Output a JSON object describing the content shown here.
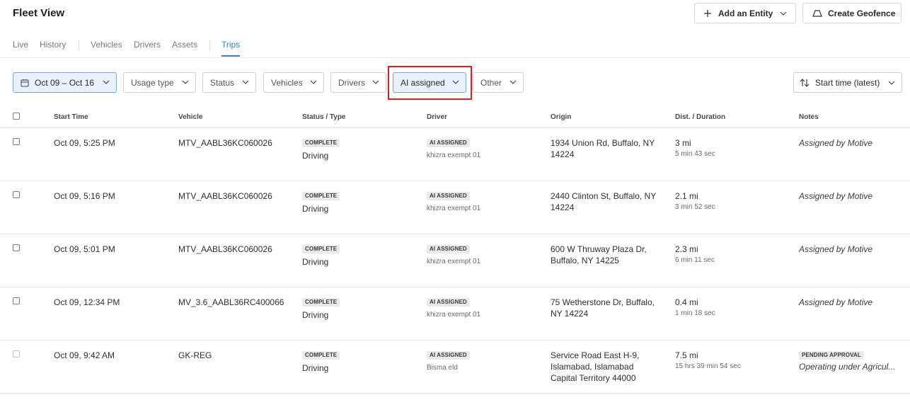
{
  "header": {
    "title": "Fleet View",
    "add_entity_label": "Add an Entity",
    "create_geofence_label": "Create Geofence"
  },
  "tabs": [
    "Live",
    "History",
    "Vehicles",
    "Drivers",
    "Assets",
    "Trips"
  ],
  "active_tab": "Trips",
  "filters": {
    "date": "Oct 09 – Oct 16",
    "usage_type": "Usage type",
    "status": "Status",
    "vehicles": "Vehicles",
    "drivers": "Drivers",
    "ai_assigned": "AI assigned",
    "other": "Other",
    "sort": "Start time (latest)"
  },
  "columns": [
    "Start Time",
    "Vehicle",
    "Status / Type",
    "Driver",
    "Origin",
    "Dist. / Duration",
    "Notes"
  ],
  "rows": [
    {
      "start": "Oct 09, 5:25 PM",
      "vehicle": "MTV_AABL36KC060026",
      "status": "COMPLETE",
      "type": "Driving",
      "driver_badge": "AI ASSIGNED",
      "driver": "khizra exempt 01",
      "origin": [
        "1934 Union Rd, Buffalo, NY",
        "14224"
      ],
      "dist": "3 mi",
      "duration": "5 min 43 sec",
      "note_badge": "",
      "notes": "Assigned by Motive"
    },
    {
      "start": "Oct 09, 5:16 PM",
      "vehicle": "MTV_AABL36KC060026",
      "status": "COMPLETE",
      "type": "Driving",
      "driver_badge": "AI ASSIGNED",
      "driver": "khizra exempt 01",
      "origin": [
        "2440 Clinton St, Buffalo, NY",
        "14224"
      ],
      "dist": "2.1 mi",
      "duration": "3 min 52 sec",
      "note_badge": "",
      "notes": "Assigned by Motive"
    },
    {
      "start": "Oct 09, 5:01 PM",
      "vehicle": "MTV_AABL36KC060026",
      "status": "COMPLETE",
      "type": "Driving",
      "driver_badge": "AI ASSIGNED",
      "driver": "khizra exempt 01",
      "origin": [
        "600 W Thruway Plaza Dr,",
        "Buffalo, NY 14225"
      ],
      "dist": "2.3 mi",
      "duration": "6 min 11 sec",
      "note_badge": "",
      "notes": "Assigned by Motive"
    },
    {
      "start": "Oct 09, 12:34 PM",
      "vehicle": "MV_3.6_AABL36RC400066",
      "status": "COMPLETE",
      "type": "Driving",
      "driver_badge": "AI ASSIGNED",
      "driver": "khizra exempt 01",
      "origin": [
        "75 Wetherstone Dr, Buffalo,",
        "NY 14224"
      ],
      "dist": "0.4 mi",
      "duration": "1 min 18 sec",
      "note_badge": "",
      "notes": "Assigned by Motive"
    },
    {
      "start": "Oct 09, 9:42 AM",
      "vehicle": "GK-REG",
      "status": "COMPLETE",
      "type": "Driving",
      "driver_badge": "AI ASSIGNED",
      "driver": "Bisma eld",
      "origin": [
        "Service Road East H-9,",
        "Islamabad, Islamabad",
        "Capital Territory 44000"
      ],
      "dist": "7.5 mi",
      "duration": "15 hrs 39 min 54 sec",
      "note_badge": "PENDING APPROVAL",
      "notes": "Operating under Agricul..."
    }
  ]
}
